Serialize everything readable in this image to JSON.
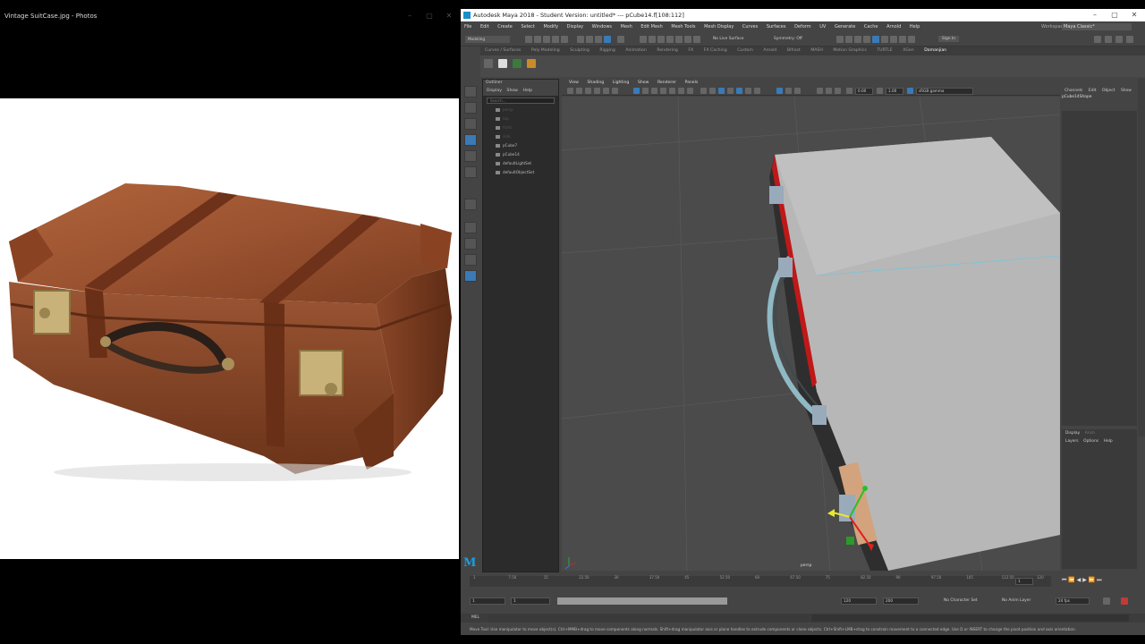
{
  "photos": {
    "title": "Vintage SuitCase.jpg - Photos"
  },
  "maya": {
    "title": "Autodesk Maya 2018 - Student Version: untitled*   ---   pCube14.f[108:112]",
    "menus": [
      "File",
      "Edit",
      "Create",
      "Select",
      "Modify",
      "Display",
      "Windows",
      "Mesh",
      "Edit Mesh",
      "Mesh Tools",
      "Mesh Display",
      "Curves",
      "Surfaces",
      "Deform",
      "UV",
      "Generate",
      "Cache",
      "Arnold",
      "Help"
    ],
    "workspace_label": "Workspace:",
    "workspace_value": "Maya Classic*",
    "mode": "Modeling",
    "live_surface": "No Live Surface",
    "symmetry": "Symmetry: Off",
    "sign_in": "Sign In",
    "shelf_tabs": [
      "Curves / Surfaces",
      "Poly Modeling",
      "Sculpting",
      "Rigging",
      "Animation",
      "Rendering",
      "FX",
      "FX Caching",
      "Custom",
      "Arnold",
      "Bifrost",
      "MASH",
      "Motion Graphics",
      "TURTLE",
      "XGen",
      "Damanjian"
    ],
    "shelf_active": "Damanjian",
    "outliner": {
      "title": "Outliner",
      "menus": [
        "Display",
        "Show",
        "Help"
      ],
      "search": "Search...",
      "items": [
        {
          "label": "persp",
          "dim": true
        },
        {
          "label": "top",
          "dim": true
        },
        {
          "label": "front",
          "dim": true
        },
        {
          "label": "side",
          "dim": true
        },
        {
          "label": "pCube7",
          "dim": false
        },
        {
          "label": "pCube14",
          "dim": false
        },
        {
          "label": "defaultLightSet",
          "dim": false
        },
        {
          "label": "defaultObjectSet",
          "dim": false
        }
      ]
    },
    "viewport_menus": [
      "View",
      "Shading",
      "Lighting",
      "Show",
      "Renderer",
      "Panels"
    ],
    "viewport_fields": {
      "a": "0.00",
      "b": "1.00",
      "colorspace": "sRGB gamma"
    },
    "camera_label": "persp",
    "channel_box": {
      "tabs": [
        "Channels",
        "Edit",
        "Object",
        "Show"
      ],
      "object": "pCube14Shape",
      "display_tabs": [
        "Display",
        "Anim"
      ],
      "layer_menus": [
        "Layers",
        "Options",
        "Help"
      ]
    },
    "timeline": {
      "ticks": [
        "1",
        "7.50",
        "15",
        "22.50",
        "30",
        "37.50",
        "45",
        "52.50",
        "60",
        "67.50",
        "75",
        "82.50",
        "90",
        "97.50",
        "105",
        "112.50",
        "120"
      ],
      "current_frame": "1",
      "range_start": "1",
      "range_inner_start": "1",
      "range_inner_end": "120",
      "range_end": "120",
      "anim_end": "200",
      "character_set": "No Character Set",
      "anim_layer": "No Anim Layer",
      "fps": "24 fps"
    },
    "mel_label": "MEL",
    "help_line": "Move Tool: Use manipulator to move object(s). Ctrl+MMB+drag to move components along normals. Shift+drag manipulator axis or plane handles to extrude components or clone objects. Ctrl+Shift+LMB+drag to constrain movement to a connected edge. Use D or INSERT to change the pivot position and axis orientation."
  }
}
